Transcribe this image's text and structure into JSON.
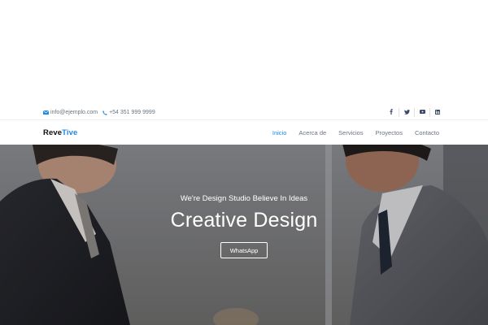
{
  "topbar": {
    "email": "info@ejemplo.com",
    "phone": "+54 351 999 9999",
    "icons": [
      "envelope-icon",
      "phone-icon"
    ],
    "socials": [
      "facebook-icon",
      "twitter-icon",
      "youtube-icon",
      "linkedin-icon"
    ]
  },
  "navbar": {
    "brand_part1": "Reve",
    "brand_part2": "Tive",
    "menu": [
      {
        "label": "Inicio",
        "active": true
      },
      {
        "label": "Acerca de",
        "active": false
      },
      {
        "label": "Servicios",
        "active": false
      },
      {
        "label": "Proyectos",
        "active": false
      },
      {
        "label": "Contacto",
        "active": false
      }
    ]
  },
  "hero": {
    "subtitle": "We're Design Studio Believe In Ideas",
    "title": "Creative Design",
    "button_label": "WhatsApp"
  },
  "colors": {
    "accent": "#1e88e5",
    "text_muted": "#6b7280",
    "hero_text": "#ffffff"
  }
}
